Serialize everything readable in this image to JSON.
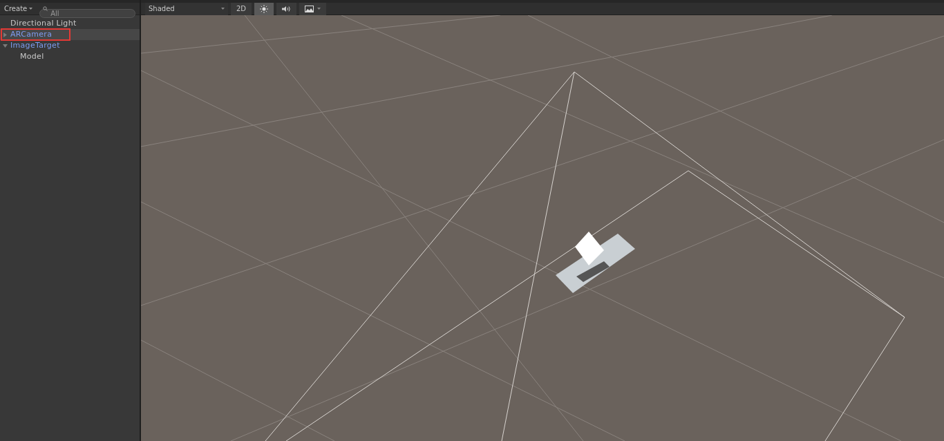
{
  "hierarchy": {
    "create_label": "Create",
    "search": {
      "placeholder": "All"
    },
    "items": [
      {
        "name": "Directional Light",
        "kind": "object",
        "selected": false,
        "outlined": false
      },
      {
        "name": "ARCamera",
        "kind": "prefab",
        "selected": true,
        "expanded": false,
        "outlined": true
      },
      {
        "name": "ImageTarget",
        "kind": "prefab",
        "selected": false,
        "expanded": true,
        "outlined": false,
        "children": [
          {
            "name": "Model",
            "kind": "object",
            "selected": false,
            "outlined": false
          }
        ]
      }
    ]
  },
  "scene_toolbar": {
    "draw_mode": "Shaded",
    "mode_2d": {
      "label": "2D",
      "on": false
    },
    "lighting_on": true,
    "audio_on": false,
    "effects_on": false
  }
}
